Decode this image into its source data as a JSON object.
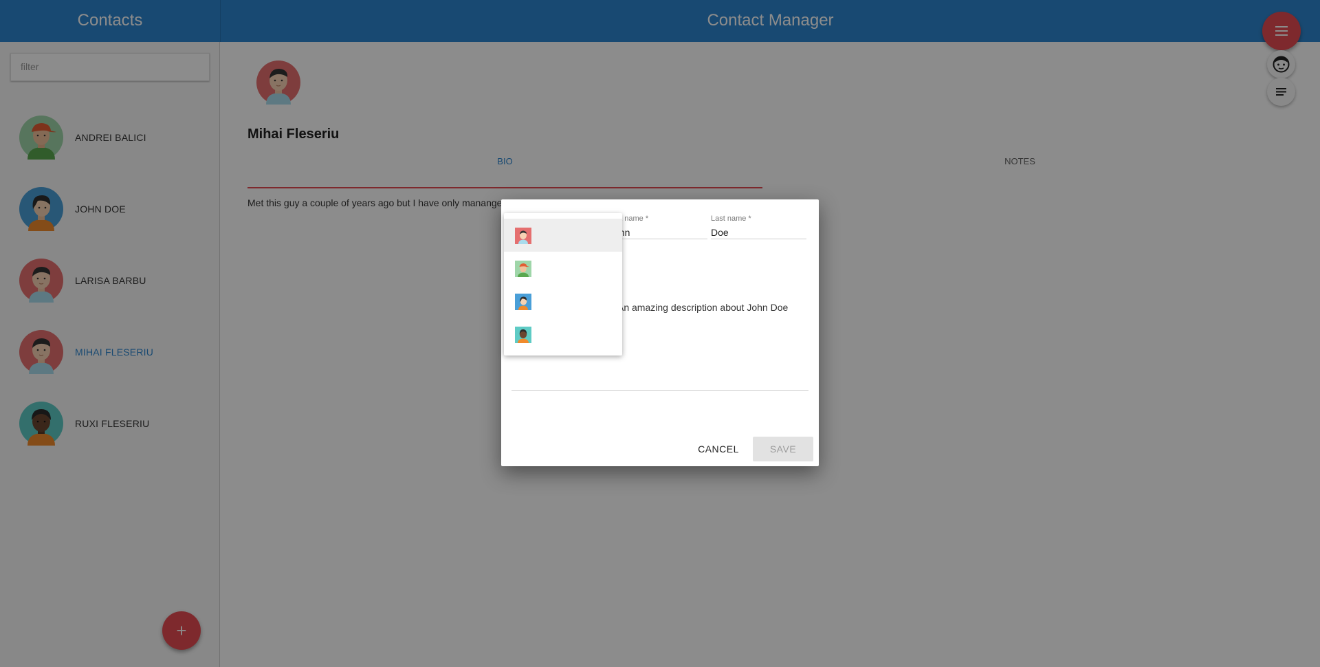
{
  "header": {
    "left_title": "Contacts",
    "main_title": "Contact Manager"
  },
  "sidebar": {
    "filter_placeholder": "filter",
    "contacts": [
      {
        "name": "ANDREI BALICI",
        "avatar": "avatar-boy-cap-icon",
        "active": false
      },
      {
        "name": "JOHN DOE",
        "avatar": "avatar-girl-blue-icon",
        "active": false
      },
      {
        "name": "LARISA BARBU",
        "avatar": "avatar-man-red-icon",
        "active": false
      },
      {
        "name": "MIHAI FLESERIU",
        "avatar": "avatar-man-red-icon",
        "active": true
      },
      {
        "name": "RUXI FLESERIU",
        "avatar": "avatar-dark-teal-icon",
        "active": false
      }
    ],
    "add_button": "+"
  },
  "main": {
    "selected_name": "Mihai Fleseriu",
    "tabs": [
      {
        "label": "BIO",
        "active": true
      },
      {
        "label": "NOTES",
        "active": false
      }
    ],
    "bio_text": "Met this guy a couple of years ago but I have only mananged"
  },
  "dialog": {
    "first_name_label": "rst name *",
    "first_name_value": "ohn",
    "last_name_label": "Last name *",
    "last_name_value": "Doe",
    "description": "An amazing description about John Doe",
    "cancel_label": "CANCEL",
    "save_label": "SAVE",
    "avatar_options": [
      "avatar-man-red-icon",
      "avatar-boy-cap-icon",
      "avatar-girl-blue-icon",
      "avatar-dark-teal-icon"
    ]
  },
  "colors": {
    "primary": "#2d86cf",
    "accent": "#e64c53",
    "overlay": "rgba(0,0,0,0.45)"
  }
}
